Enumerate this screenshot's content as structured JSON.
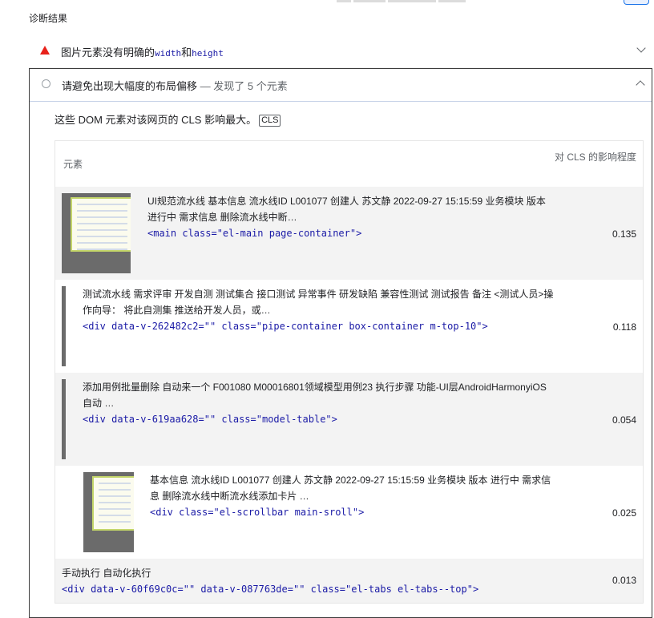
{
  "section_title": "诊断结果",
  "audit_image_size": {
    "title_prefix": "图片元素没有明确的",
    "code_width": "width",
    "title_and": "和",
    "code_height": "height"
  },
  "audit_cls": {
    "title": "请避免出现大幅度的布局偏移",
    "separator": " — ",
    "found": "发现了 5 个元素",
    "description": "这些 DOM 元素对该网页的 CLS 影响最大。",
    "badge": "CLS",
    "table": {
      "header_element": "元素",
      "header_impact": "对 CLS 的影响程度",
      "rows": [
        {
          "text_line1": "UI规范流水线 基本信息 流水线ID L001077 创建人 苏文静 2022-09-27 15:15:59 业务模块 版本",
          "text_line2": "进行中 需求信息 删除流水线中断…",
          "code": "<main class=\"el-main page-container\">",
          "value": "0.135"
        },
        {
          "text_line1": "测试流水线 需求评审 开发自测 测试集合 接口测试 异常事件 研发缺陷 兼容性测试 测试报告 备注 <测试人员>操",
          "text_line2": "作向导： 将此自测集 推送给开发人员，或…",
          "code": "<div data-v-262482c2=\"\" class=\"pipe-container box-container m-top-10\">",
          "value": "0.118"
        },
        {
          "text_line1": "添加用例批量删除 自动来一个 F001080 M00016801领域模型用例23 执行步骤 功能-UI层AndroidHarmonyiOS",
          "text_line2": "自动 …",
          "code": "<div data-v-619aa628=\"\" class=\"model-table\">",
          "value": "0.054"
        },
        {
          "text_line1": "基本信息 流水线ID L001077 创建人 苏文静 2022-09-27 15:15:59 业务模块 版本 进行中 需求信",
          "text_line2": "息 删除流水线中断流水线添加卡片 …",
          "code": "<div class=\"el-scrollbar main-sroll\">",
          "value": "0.025"
        },
        {
          "text_line1": "手动执行 自动化执行",
          "text_line2": "",
          "code": "<div data-v-60f69c0c=\"\" data-v-087763de=\"\" class=\"el-tabs el-tabs--top\">",
          "value": "0.013"
        }
      ]
    }
  }
}
